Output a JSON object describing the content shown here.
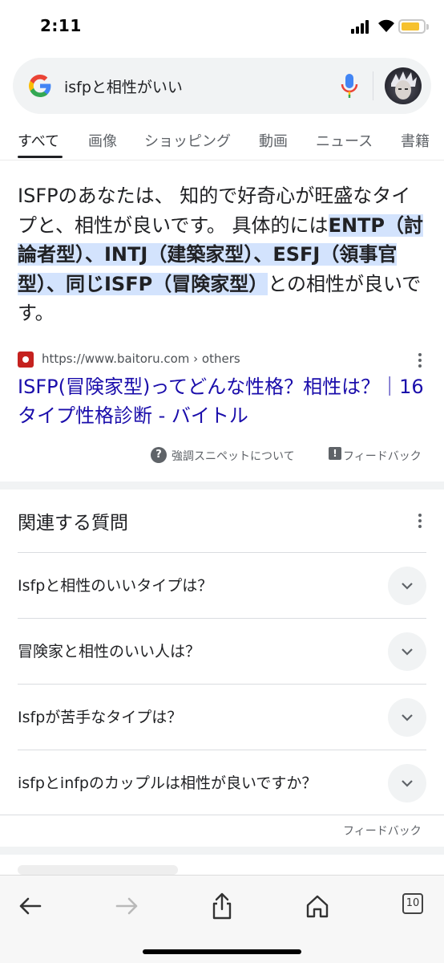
{
  "status_bar": {
    "time": "2:11"
  },
  "search": {
    "query": "isfpと相性がいい"
  },
  "tabs": [
    {
      "label": "すべて",
      "active": true
    },
    {
      "label": "画像"
    },
    {
      "label": "ショッピング"
    },
    {
      "label": "動画"
    },
    {
      "label": "ニュース"
    },
    {
      "label": "書籍"
    }
  ],
  "snippet": {
    "text_1": "ISFPのあなたは、 知的で好奇心が旺盛なタイプと、相性が良いです。 具体的には",
    "highlight_1": "ENTP（討論者型）、INTJ（建築家型）、ESFJ（領事官型）、同じISFP（冒険家型）",
    "text_2": "との相性が良いです。",
    "source_url": "https://www.baitoru.com › others",
    "link_title": "ISFP(冒険家型)ってどんな性格？相性は？｜16タイプ性格診断 - バイトル",
    "about_label": "強調スニペットについて",
    "feedback_label": "フィードバック"
  },
  "related_questions": {
    "title": "関連する質問",
    "items": [
      "Isfpと相性のいいタイプは？",
      "冒険家と相性のいい人は？",
      "Isfpが苦手なタイプは？",
      "isfpとinfpのカップルは相性が良いですか？"
    ],
    "feedback_label": "フィードバック"
  },
  "toolbar": {
    "tab_count": "10"
  },
  "icons": {
    "search_logo": "google-g-icon",
    "mic": "microphone-icon",
    "back": "back-arrow-icon",
    "forward": "forward-arrow-icon",
    "share": "share-icon",
    "home": "home-icon",
    "tabs": "tabs-icon"
  },
  "colors": {
    "link": "#1a0dab",
    "highlight": "#d3e3fd",
    "text": "#202124",
    "muted": "#5f6368"
  }
}
